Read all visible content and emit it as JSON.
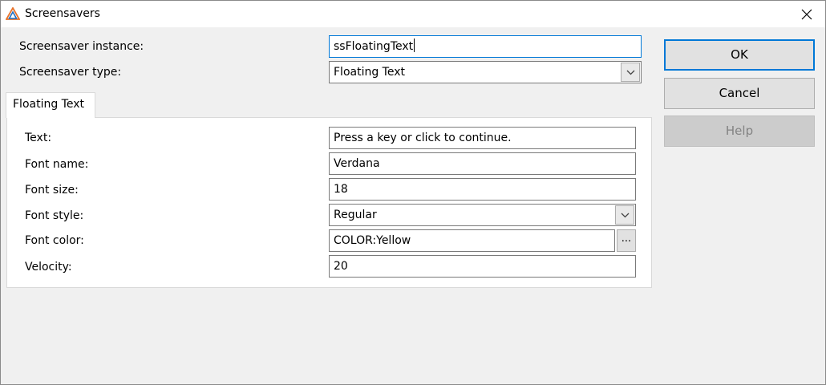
{
  "window": {
    "title": "Screensavers",
    "close_glyph": "close-icon"
  },
  "header": {
    "instance_label": "Screensaver instance:",
    "instance_value": "ssFloatingText",
    "type_label": "Screensaver type:",
    "type_value": "Floating Text"
  },
  "buttons": {
    "ok": "OK",
    "cancel": "Cancel",
    "help": "Help"
  },
  "tab": {
    "label": "Floating Text"
  },
  "props": {
    "text_label": "Text:",
    "text_value": "Press a key or click to continue.",
    "font_name_label": "Font name:",
    "font_name_value": "Verdana",
    "font_size_label": "Font size:",
    "font_size_value": "18",
    "font_style_label": "Font style:",
    "font_style_value": "Regular",
    "font_color_label": "Font color:",
    "font_color_value": "COLOR:Yellow",
    "browse_label": "...",
    "velocity_label": "Velocity:",
    "velocity_value": "20"
  },
  "colors": {
    "accent": "#0078d7",
    "window_bg": "#f0f0f0",
    "panel_bg": "#ffffff"
  }
}
